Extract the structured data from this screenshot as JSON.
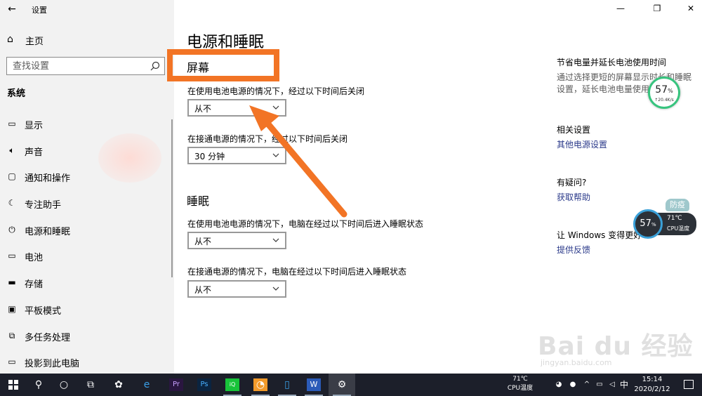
{
  "window": {
    "app_title": "设置",
    "minimize_glyph": "—",
    "maximize_glyph": "❐",
    "close_glyph": "✕"
  },
  "sidebar": {
    "home_label": "主页",
    "search_placeholder": "查找设置",
    "section_label": "系统",
    "items": [
      {
        "label": "显示",
        "icon": "display-icon"
      },
      {
        "label": "声音",
        "icon": "sound-icon"
      },
      {
        "label": "通知和操作",
        "icon": "notification-icon"
      },
      {
        "label": "专注助手",
        "icon": "moon-icon"
      },
      {
        "label": "电源和睡眠",
        "icon": "power-icon"
      },
      {
        "label": "电池",
        "icon": "battery-icon"
      },
      {
        "label": "存储",
        "icon": "storage-icon"
      },
      {
        "label": "平板模式",
        "icon": "tablet-icon"
      },
      {
        "label": "多任务处理",
        "icon": "multitask-icon"
      },
      {
        "label": "投影到此电脑",
        "icon": "project-icon"
      }
    ]
  },
  "main": {
    "page_title": "电源和睡眠",
    "screen_heading": "屏幕",
    "screen_battery_label": "在使用电池电源的情况下，经过以下时间后关闭",
    "screen_battery_value": "从不",
    "screen_plugged_label": "在接通电源的情况下，经过以下时间后关闭",
    "screen_plugged_value": "30 分钟",
    "sleep_heading": "睡眠",
    "sleep_battery_label": "在使用电池电源的情况下，电脑在经过以下时间后进入睡眠状态",
    "sleep_battery_value": "从不",
    "sleep_plugged_label": "在接通电源的情况下，电脑在经过以下时间后进入睡眠状态",
    "sleep_plugged_value": "从不"
  },
  "right": {
    "battery_tip_heading": "节省电量并延长电池使用时间",
    "battery_tip_line1": "通过选择更短的屏幕显示时长和睡眠",
    "battery_tip_line2": "设置，延长电池电量使用时间。",
    "related_heading": "相关设置",
    "related_link": "其他电源设置",
    "question_heading": "有疑问?",
    "question_link": "获取帮助",
    "better_heading": "让 Windows 变得更好",
    "feedback_link": "提供反馈"
  },
  "widgets": {
    "net_percent": "57",
    "net_percent_unit": "%",
    "net_speed": "↑20.4K/s",
    "badge": "防疫",
    "cpu_percent": "57",
    "cpu_percent_unit": "%",
    "cpu_temp": "71℃",
    "cpu_label": "CPU温度"
  },
  "taskbar": {
    "temp": "71℃",
    "temp_label": "CPU温度",
    "ime": "中",
    "time": "15:14",
    "date": "2020/2/12"
  },
  "watermark": {
    "brand": "Bai du 经验",
    "url": "jingyan.baidu.com"
  },
  "colors": {
    "highlight": "#f27425",
    "link": "#2b3a8a",
    "taskbar": "#1c1f2a"
  }
}
